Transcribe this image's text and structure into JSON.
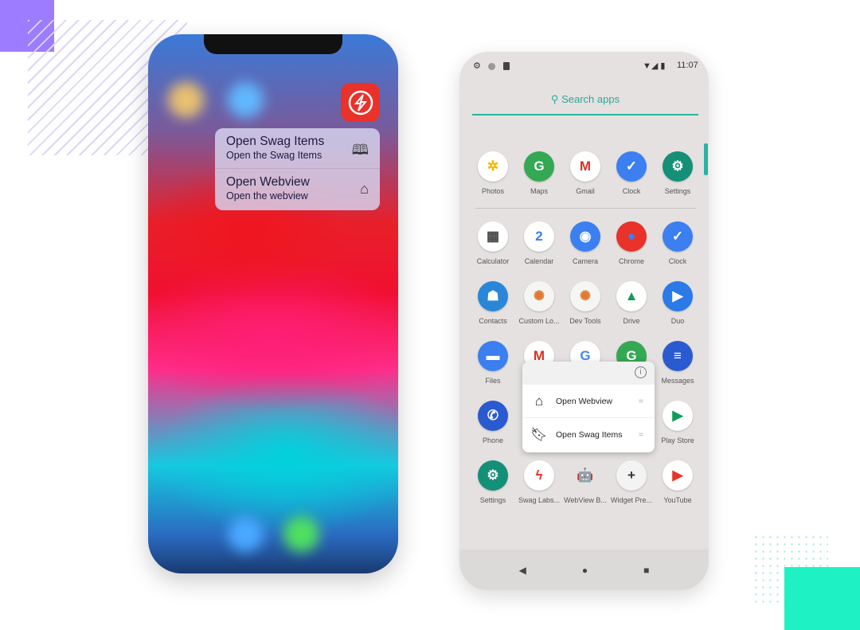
{
  "colors": {
    "accent_purple": "#9d7cff",
    "accent_teal": "#1ef2c4",
    "android_teal": "#2bb3a3",
    "swag_red": "#e8322a"
  },
  "ios": {
    "app_icon": "swag-labs-lightning-icon",
    "menu": [
      {
        "title": "Open Swag Items",
        "subtitle": "Open the Swag Items",
        "icon": "book-icon"
      },
      {
        "title": "Open Webview",
        "subtitle": "Open the webview",
        "icon": "home-icon"
      }
    ]
  },
  "android": {
    "status": {
      "time": "11:07"
    },
    "search_label": "Search apps",
    "apps": [
      [
        {
          "label": "Photos",
          "color": "#ffffff",
          "glyph": "✲",
          "fg": "#f4b400"
        },
        {
          "label": "Maps",
          "color": "#34a853",
          "glyph": "G",
          "fg": "#fff"
        },
        {
          "label": "Gmail",
          "color": "#ffffff",
          "glyph": "M",
          "fg": "#d93025"
        },
        {
          "label": "Clock",
          "color": "#3b7ff0",
          "glyph": "✓",
          "fg": "#fff"
        },
        {
          "label": "Settings",
          "color": "#148f78",
          "glyph": "⚙",
          "fg": "#fff"
        }
      ],
      [
        {
          "label": "Calculator",
          "color": "#ffffff",
          "glyph": "▦",
          "fg": "#444"
        },
        {
          "label": "Calendar",
          "color": "#ffffff",
          "glyph": "2",
          "fg": "#3b7ff0"
        },
        {
          "label": "Camera",
          "color": "#3b7ff0",
          "glyph": "◉",
          "fg": "#fff"
        },
        {
          "label": "Chrome",
          "color": "#e8322a",
          "glyph": "●",
          "fg": "#3b7ff0"
        },
        {
          "label": "Clock",
          "color": "#3b7ff0",
          "glyph": "✓",
          "fg": "#fff"
        }
      ],
      [
        {
          "label": "Contacts",
          "color": "#2a87d8",
          "glyph": "☗",
          "fg": "#fff"
        },
        {
          "label": "Custom Lo...",
          "color": "#f5f5f5",
          "glyph": "✺",
          "fg": "#e07a30"
        },
        {
          "label": "Dev Tools",
          "color": "#f5f5f5",
          "glyph": "✺",
          "fg": "#e07a30"
        },
        {
          "label": "Drive",
          "color": "#ffffff",
          "glyph": "▲",
          "fg": "#0f9d58"
        },
        {
          "label": "Duo",
          "color": "#2a7ae8",
          "glyph": "▶",
          "fg": "#fff"
        }
      ],
      [
        {
          "label": "Files",
          "color": "#3b7ff0",
          "glyph": "▬",
          "fg": "#fff"
        },
        {
          "label": "",
          "color": "#ffffff",
          "glyph": "M",
          "fg": "#d93025"
        },
        {
          "label": "",
          "color": "#ffffff",
          "glyph": "G",
          "fg": "#4285f4"
        },
        {
          "label": "",
          "color": "#34a853",
          "glyph": "G",
          "fg": "#fff"
        },
        {
          "label": "Messages",
          "color": "#2a5ad0",
          "glyph": "≡",
          "fg": "#fff"
        }
      ],
      [
        {
          "label": "Phone",
          "color": "#2a5ad0",
          "glyph": "✆",
          "fg": "#fff"
        },
        {
          "label": "",
          "color": "transparent",
          "glyph": "",
          "fg": "#fff"
        },
        {
          "label": "",
          "color": "transparent",
          "glyph": "",
          "fg": "#fff"
        },
        {
          "label": "",
          "color": "transparent",
          "glyph": "",
          "fg": "#fff"
        },
        {
          "label": "Play Store",
          "color": "#ffffff",
          "glyph": "▶",
          "fg": "#0f9d58"
        }
      ],
      [
        {
          "label": "Settings",
          "color": "#148f78",
          "glyph": "⚙",
          "fg": "#fff"
        },
        {
          "label": "Swag Labs...",
          "color": "#ffffff",
          "glyph": "ϟ",
          "fg": "#e8322a"
        },
        {
          "label": "WebView B...",
          "color": "transparent",
          "glyph": "🤖",
          "fg": "#7cb342"
        },
        {
          "label": "Widget Pre...",
          "color": "#f3f3f3",
          "glyph": "+",
          "fg": "#333"
        },
        {
          "label": "YouTube",
          "color": "#ffffff",
          "glyph": "▶",
          "fg": "#e8322a"
        }
      ]
    ],
    "popup": {
      "info_icon": "info-icon",
      "items": [
        {
          "label": "Open Webview",
          "icon": "home-icon"
        },
        {
          "label": "Open Swag Items",
          "icon": "bookmark-icon"
        }
      ]
    }
  }
}
